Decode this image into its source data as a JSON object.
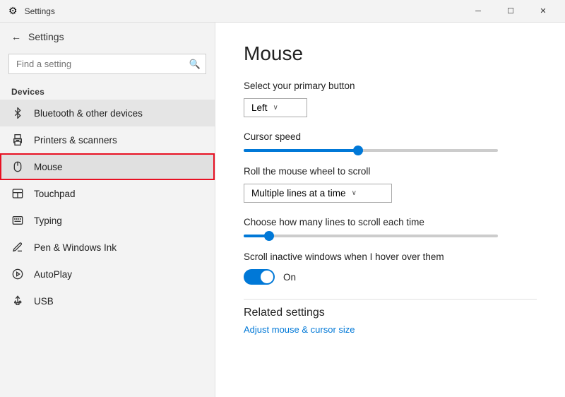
{
  "titlebar": {
    "title": "Settings",
    "minimize_label": "─",
    "maximize_label": "☐",
    "close_label": "✕"
  },
  "sidebar": {
    "back_label": "Settings",
    "search_placeholder": "Find a setting",
    "search_icon": "🔍",
    "section_label": "Devices",
    "items": [
      {
        "id": "bluetooth",
        "label": "Bluetooth & other devices",
        "icon": "bluetooth",
        "highlighted": true
      },
      {
        "id": "printers",
        "label": "Printers & scanners",
        "icon": "printer"
      },
      {
        "id": "mouse",
        "label": "Mouse",
        "icon": "mouse",
        "active": true
      },
      {
        "id": "touchpad",
        "label": "Touchpad",
        "icon": "touchpad"
      },
      {
        "id": "typing",
        "label": "Typing",
        "icon": "typing"
      },
      {
        "id": "pen",
        "label": "Pen & Windows Ink",
        "icon": "pen"
      },
      {
        "id": "autoplay",
        "label": "AutoPlay",
        "icon": "autoplay"
      },
      {
        "id": "usb",
        "label": "USB",
        "icon": "usb"
      }
    ]
  },
  "content": {
    "title": "Mouse",
    "primary_button_label": "Select your primary button",
    "primary_button_value": "Left",
    "cursor_speed_label": "Cursor speed",
    "cursor_speed_value": 45,
    "scroll_label": "Roll the mouse wheel to scroll",
    "scroll_value": "Multiple lines at a time",
    "lines_label": "Choose how many lines to scroll each time",
    "lines_value": 5,
    "inactive_label": "Scroll inactive windows when I hover over them",
    "inactive_value": "On",
    "related_title": "Related settings",
    "related_link": "Adjust mouse & cursor size"
  }
}
